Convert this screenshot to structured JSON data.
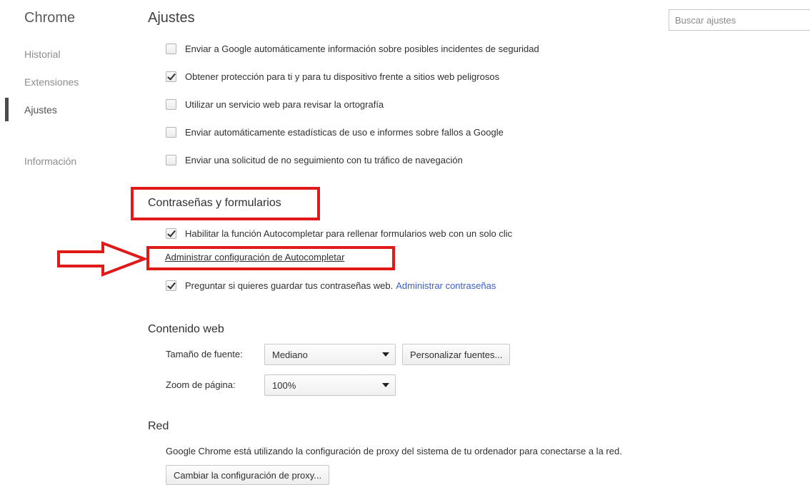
{
  "sidebar": {
    "brand": "Chrome",
    "items": [
      {
        "label": "Historial"
      },
      {
        "label": "Extensiones"
      },
      {
        "label": "Ajustes"
      },
      {
        "label": "Información"
      }
    ]
  },
  "header": {
    "title": "Ajustes",
    "search_placeholder": "Buscar ajustes"
  },
  "privacy": {
    "options": [
      {
        "label": "Enviar a Google automáticamente información sobre posibles incidentes de seguridad",
        "checked": false
      },
      {
        "label": "Obtener protección para ti y para tu dispositivo frente a sitios web peligrosos",
        "checked": true
      },
      {
        "label": "Utilizar un servicio web para revisar la ortografía",
        "checked": false
      },
      {
        "label": "Enviar automáticamente estadísticas de uso e informes sobre fallos a Google",
        "checked": false
      },
      {
        "label": "Enviar una solicitud de no seguimiento con tu tráfico de navegación",
        "checked": false
      }
    ]
  },
  "passwords": {
    "title": "Contraseñas y formularios",
    "autofill_label": "Habilitar la función Autocompletar para rellenar formularios web con un solo clic",
    "autofill_checked": true,
    "autofill_link": "Administrar configuración de Autocompletar",
    "save_passwords_label": "Preguntar si quieres guardar tus contraseñas web.",
    "save_passwords_checked": true,
    "manage_passwords_link": "Administrar contraseñas"
  },
  "web_content": {
    "title": "Contenido web",
    "font_size_label": "Tamaño de fuente:",
    "font_size_value": "Mediano",
    "customize_fonts_button": "Personalizar fuentes...",
    "page_zoom_label": "Zoom de página:",
    "page_zoom_value": "100%"
  },
  "network": {
    "title": "Red",
    "description": "Google Chrome está utilizando la configuración de proxy del sistema de tu ordenador para conectarse a la red.",
    "change_proxy_button": "Cambiar la configuración de proxy..."
  },
  "annotation_color": "#e01919"
}
